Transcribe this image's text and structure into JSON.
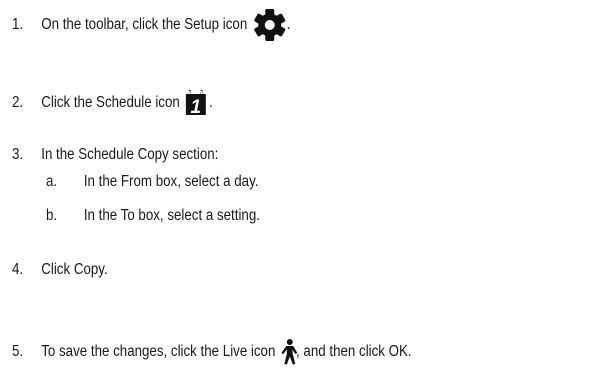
{
  "steps": [
    {
      "num": "1.",
      "text": "On the toolbar, click the Setup icon",
      "after": "."
    },
    {
      "num": "2.",
      "text": "Click the Schedule icon",
      "after": "."
    },
    {
      "num": "3.",
      "text": "In the Schedule Copy section:",
      "sub": [
        {
          "letter": "a.",
          "text": "In the From box, select a day."
        },
        {
          "letter": "b.",
          "text": "In the To box, select a setting."
        }
      ]
    },
    {
      "num": "4.",
      "text": "Click Copy."
    },
    {
      "num": "5.",
      "text": "To save the changes, click the Live icon",
      "after": ", and then click OK."
    }
  ],
  "icons": {
    "setup": "gear-icon",
    "schedule": "calendar-icon",
    "live": "walking-person-icon"
  },
  "icon_calendar_number": "1"
}
